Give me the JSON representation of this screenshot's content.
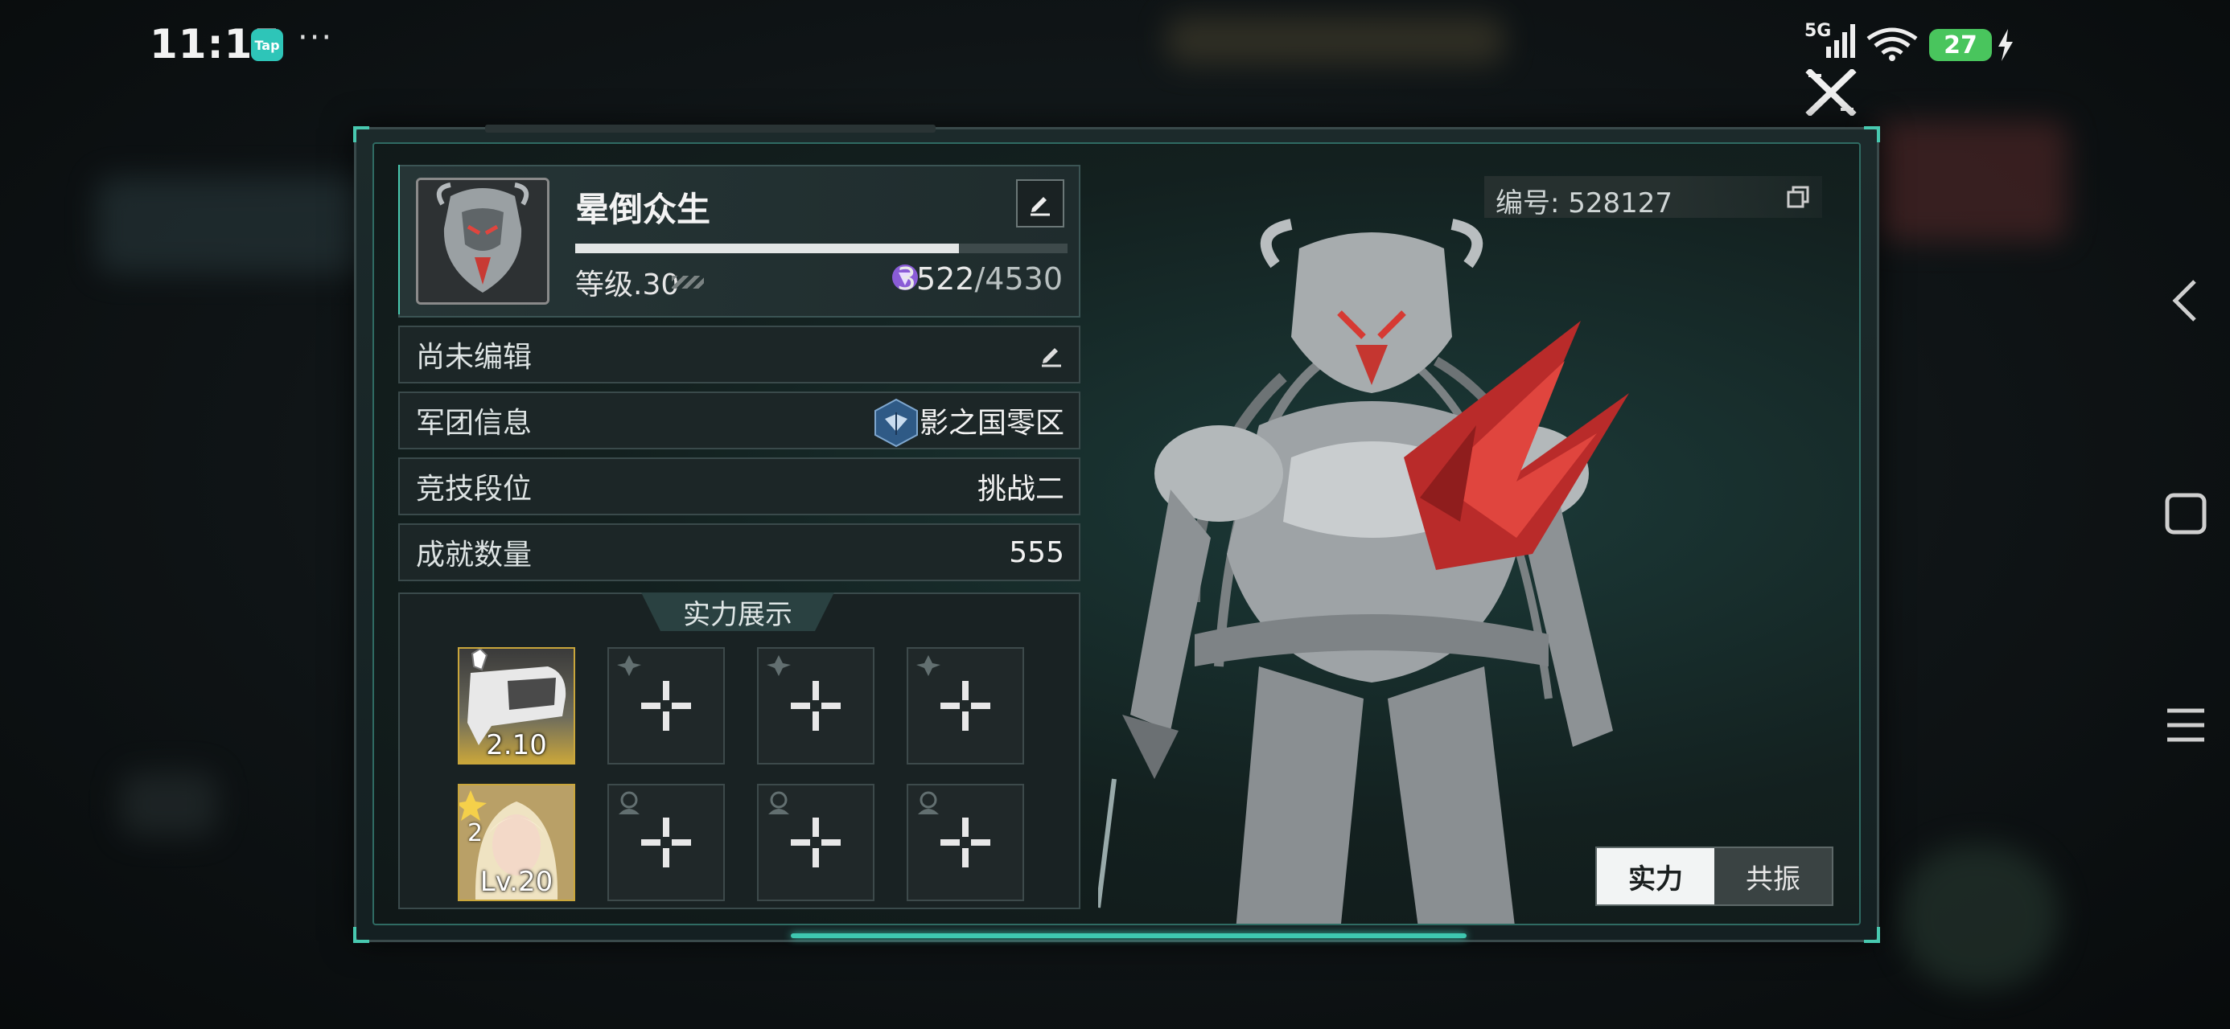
{
  "status_bar": {
    "time": "11:15",
    "tap_app": "Tap",
    "more": "···",
    "network": "5G",
    "battery": "27"
  },
  "profile": {
    "name": "晕倒众生",
    "level": "等级.30",
    "xp_current": "3522",
    "xp_total": "/4530",
    "xp_progress": 0.78,
    "id_label": "编号: 528127"
  },
  "rows": [
    {
      "label": "尚未编辑",
      "value": ""
    },
    {
      "label": "军团信息",
      "value": "影之国零区"
    },
    {
      "label": "竞技段位",
      "value": "挑战二"
    },
    {
      "label": "成就数量",
      "value": "555"
    }
  ],
  "showcase": {
    "title": "实力展示",
    "weapon_caption": "2.10",
    "character_stars": "2",
    "character_caption": "Lv.20"
  },
  "toggle": {
    "active": "实力",
    "inactive": "共振"
  },
  "colors": {
    "accent_teal": "#3ec7b0",
    "gold": "#c9a63b",
    "battery_green": "#49c55d",
    "gem_purple": "#8a5cd6"
  }
}
